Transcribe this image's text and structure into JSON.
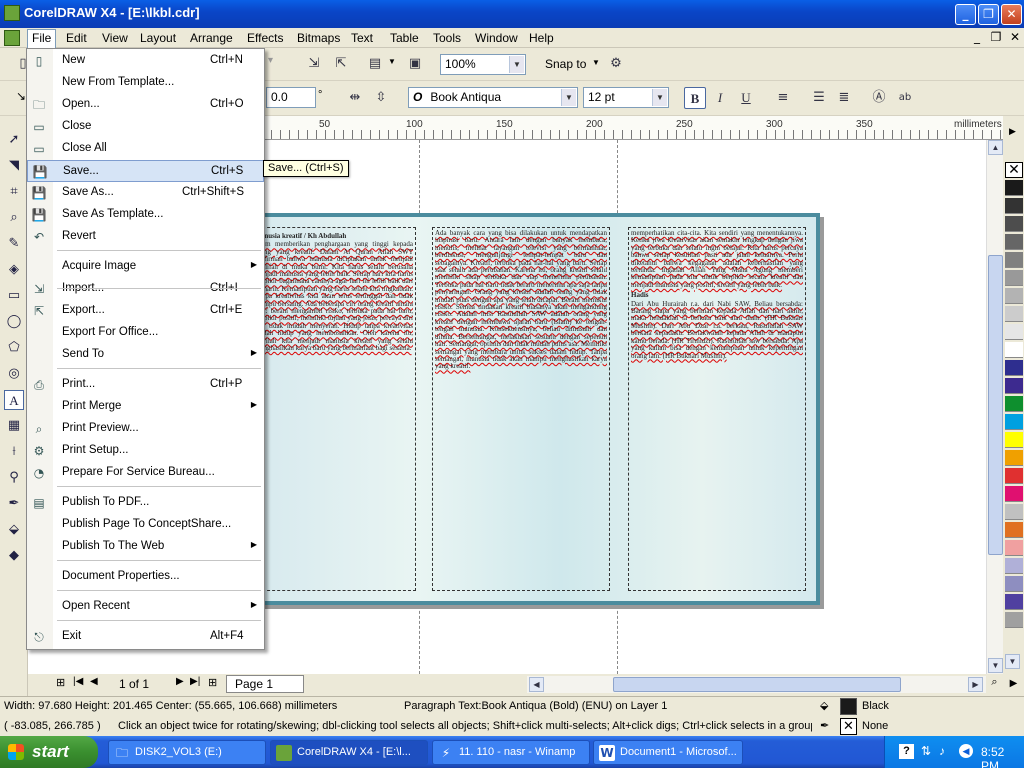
{
  "window": {
    "title": "CorelDRAW X4 - [E:\\lkbl.cdr]"
  },
  "menubar": [
    "File",
    "Edit",
    "View",
    "Layout",
    "Arrange",
    "Effects",
    "Bitmaps",
    "Text",
    "Table",
    "Tools",
    "Window",
    "Help"
  ],
  "toolbar": {
    "zoom": "100%",
    "snap_to": "Snap to",
    "angle": "0.0",
    "angle_unit": "°",
    "font_name": "Book Antiqua",
    "font_size": "12 pt",
    "font_prefix": "O"
  },
  "ruler": {
    "unit": "millimeters",
    "ticks": [
      "50",
      "100",
      "150",
      "200",
      "250",
      "300",
      "350"
    ],
    "vertical_unit": "millimeters"
  },
  "file_menu": {
    "items": [
      {
        "label": "New",
        "shortcut": "Ctrl+N",
        "icon": "new-document-icon"
      },
      {
        "label": "New From Template...",
        "shortcut": "",
        "icon": ""
      },
      {
        "label": "Open...",
        "shortcut": "Ctrl+O",
        "icon": "open-folder-icon"
      },
      {
        "label": "Close",
        "shortcut": "",
        "icon": "close-document-icon"
      },
      {
        "label": "Close All",
        "shortcut": "",
        "icon": "close-all-icon"
      },
      {
        "label": "Save...",
        "shortcut": "Ctrl+S",
        "icon": "save-icon"
      },
      {
        "label": "Save As...",
        "shortcut": "Ctrl+Shift+S",
        "icon": "save-as-icon"
      },
      {
        "label": "Save As Template...",
        "shortcut": "",
        "icon": "save-template-icon"
      },
      {
        "label": "Revert",
        "shortcut": "",
        "icon": "revert-icon"
      },
      {
        "label": "Acquire Image",
        "shortcut": "",
        "icon": ""
      },
      {
        "label": "Import...",
        "shortcut": "Ctrl+I",
        "icon": "import-icon"
      },
      {
        "label": "Export...",
        "shortcut": "Ctrl+E",
        "icon": "export-icon"
      },
      {
        "label": "Export For Office...",
        "shortcut": "",
        "icon": ""
      },
      {
        "label": "Send To",
        "shortcut": "",
        "icon": ""
      },
      {
        "label": "Print...",
        "shortcut": "Ctrl+P",
        "icon": "print-icon"
      },
      {
        "label": "Print Merge",
        "shortcut": "",
        "icon": ""
      },
      {
        "label": "Print Preview...",
        "shortcut": "",
        "icon": "print-preview-icon"
      },
      {
        "label": "Print Setup...",
        "shortcut": "",
        "icon": "print-setup-icon"
      },
      {
        "label": "Prepare For Service Bureau...",
        "shortcut": "",
        "icon": "service-bureau-icon"
      },
      {
        "label": "Publish To PDF...",
        "shortcut": "",
        "icon": "pdf-icon"
      },
      {
        "label": "Publish Page To ConceptShare...",
        "shortcut": "",
        "icon": ""
      },
      {
        "label": "Publish To The Web",
        "shortcut": "",
        "icon": ""
      },
      {
        "label": "Document Properties...",
        "shortcut": "",
        "icon": ""
      },
      {
        "label": "Open Recent",
        "shortcut": "",
        "icon": ""
      },
      {
        "label": "Exit",
        "shortcut": "Alt+F4",
        "icon": "exit-icon"
      }
    ],
    "tooltip": "Save... (Ctrl+S)"
  },
  "document": {
    "col1_heading": "manusia kreatif",
    "col1_author": "Kh Abdullah",
    "col3_heading": "Hadis",
    "col2_text": "Ada banyak cara yang bisa dilakukan untuk mendapatkan inspirasi baru. Antara lain dengan banyak membaca, menulis, melihat tayangan televisi yang bermanfaat, berdiskusi, mengunjungi tempat-tempat baru dan sebagainya. Kreatif, terbuka pada hal-hal yang baru. Setiap saat selalu ada perubahan. Karena itu, orang kreatif selalu memiliki sikap terbuka dan siap menerima perubahan. Terbuka pada hal baru tidak berarti menerima apa saja tanpa penyaringan. Orang yang kreatif adalah orang yang tidak mudah puas dengan apa yang telah dicapai. Berani memikul risiko. Semua tindakan kreatif biasanya akan mengandung risiko. Adalah misi Rasulullah SAW adalah orang yang kreatif dengan membawa ajaran baru (Islam) ke tengah-tengah manusia. Konsekuensinya, beliau dimusuhi dan dihina. Bersemangat, melakukan sesuatu dengan sepenuh hati. Semangat, optimis dan tidak mudah putus asa. Memiliki semangat yang membara untuk sukses dalam hidup. Tanpa semangat, manusia tidak akan mampu menghasilkan karya yang kreatif.",
    "col1_text": "Islam memberikan penghargaan yang tinggi kepada orang yang kreatif. Dalam Al Quran Allah SWT berfirman bahwa manusia diciptakan untuk menjadi khalifah di muka bumi. Kita harus selalu berusaha menjadi manusia yang lebih baik. Setiap hari kita harus berpikir bagaimana caranya agar hari ini lebih baik dari kemarin. Kemampuan yang harus selalu kita tingkatkan. Tanpa kreativitas kita akan terus tertinggal dan tidak mampu bersaing. Ada beberapa ciri orang kreatif antara lain: berani mengambil risiko, terbuka pada hal baru, berpikir positif, memiliki tujuan yang jelas, percaya diri dan tidak mudah menyerah. Hidup tanpa kreativitas adalah hidup yang membosankan. Oleh karena itu, marilah kita menjadi manusia kreatif yang selalu menghasilkan karya baru yang bermanfaat bagi sesama.",
    "col3_text": "memperhatikan cita-cita. Kita sendiri yang menentukannya. Ketika jiwa kreativitas akan semakin lengkap dengan jiwa yang terbuka dan selalu ingin belajar. Kita harus percaya bahwa setiap kesulitan pasti ada jalan keluarnya. Perlu diketahui bahwa kegagalan adalah keberhasilan yang tertunda. Ingatlah Allah Yang Maha Agung memberi kemampuan pada kita untuk berpikir secara kreatif dan menjadi manusia yang positif, kreatif yang lebih baik.",
    "col3_hadis": "Dari Abu Hurairah r.a. dari Nabi SAW, Beliau bersabda: Barang siapa yang beriman kepada Allah dan hari akhir, maka hendaklah ia berkata baik atau diam. (HR Bukhari Muslim). Dari Abu Dzar r.a. berkata, Rasulullah SAW berkata kepadaku: Bertakwalah kepada Allah di manapun kamu berada. (HR Tirmidzi). Rasulullah saw bersabda: Apa yang kalian bisa dengan kemampuan untuk kepentingan orang lain. (HR Bukhari Muslim)."
  },
  "pagebar": {
    "page_counter": "1 of 1",
    "page_tab": "Page 1"
  },
  "status": {
    "dimensions": "Width: 97.680  Height: 201.465  Center: (55.665, 106.668)  millimeters",
    "object": "Paragraph Text:Book Antiqua (Bold) (ENU) on Layer 1",
    "fill_label": "Black",
    "outline_label": "None",
    "coords": "( -83.085, 266.785 )",
    "hint": "Click an object twice for rotating/skewing; dbl-clicking tool selects all objects; Shift+click multi-selects; Alt+click digs; Ctrl+click selects in a group"
  },
  "taskbar": {
    "start": "start",
    "tasks": [
      {
        "label": "DISK2_VOL3 (E:)",
        "icon": "folder-icon"
      },
      {
        "label": "CorelDRAW X4 - [E:\\l...",
        "icon": "coreldraw-icon"
      },
      {
        "label": "11. 110 - nasr - Winamp",
        "icon": "winamp-icon"
      },
      {
        "label": "Document1 - Microsof...",
        "icon": "word-icon"
      }
    ],
    "clock": "8:52 PM"
  },
  "colors": {
    "palette": [
      "#1a1a1a",
      "#333333",
      "#4d4d4d",
      "#666666",
      "#808080",
      "#999999",
      "#b3b3b3",
      "#cccccc",
      "#e6e6e6",
      "#ffffff",
      "#2e2e8f",
      "#3d2a8f",
      "#0e8f2e",
      "#00a0e0",
      "#ffff00",
      "#f0a000",
      "#e03030",
      "#e01070",
      "#c0c0c0",
      "#e07020",
      "#f0a0a0",
      "#b0b0d8",
      "#8e8ec0",
      "#5040a0",
      "#a0a0a0"
    ],
    "title_blue": "#0a46c8",
    "doc_border": "#4b8c9e"
  }
}
